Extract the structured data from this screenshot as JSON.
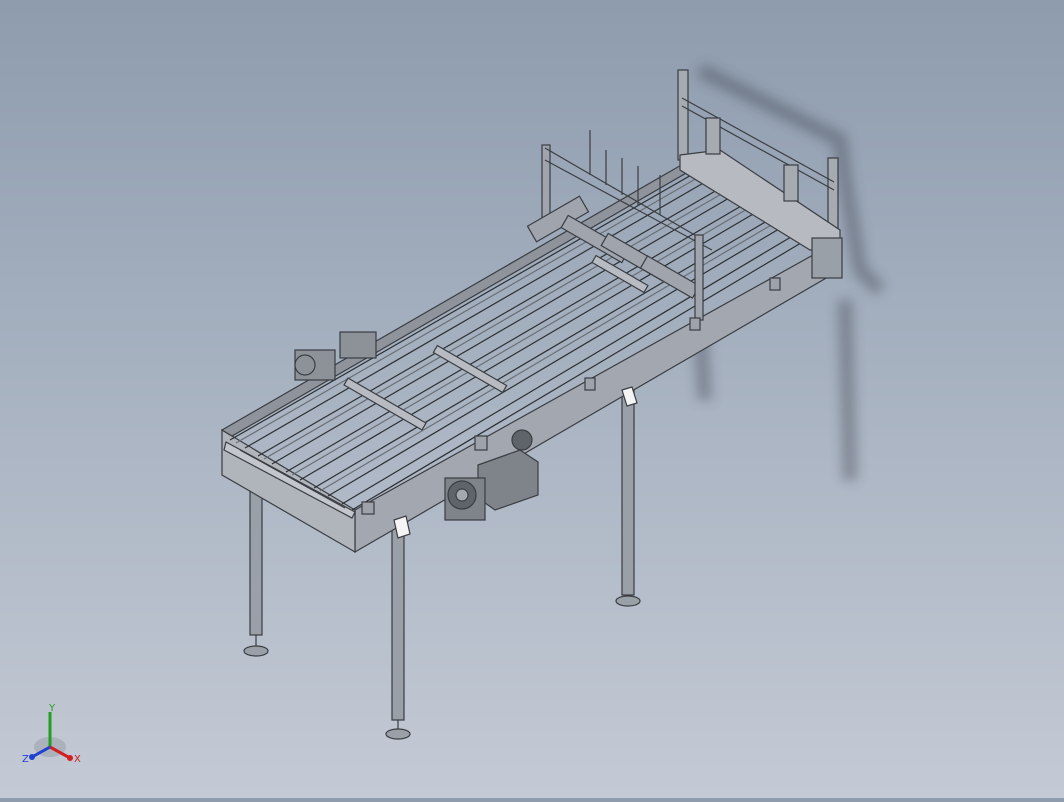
{
  "viewport": {
    "background_top": "#8e9cae",
    "background_bottom": "#c4cad5",
    "model_line_color": "#3a3d42",
    "model_fill_color": "#9aa0a8"
  },
  "triad": {
    "x_label": "X",
    "y_label": "Y",
    "z_label": "Z",
    "x_color": "#d22020",
    "y_color": "#1fa01f",
    "z_color": "#2040d0"
  }
}
